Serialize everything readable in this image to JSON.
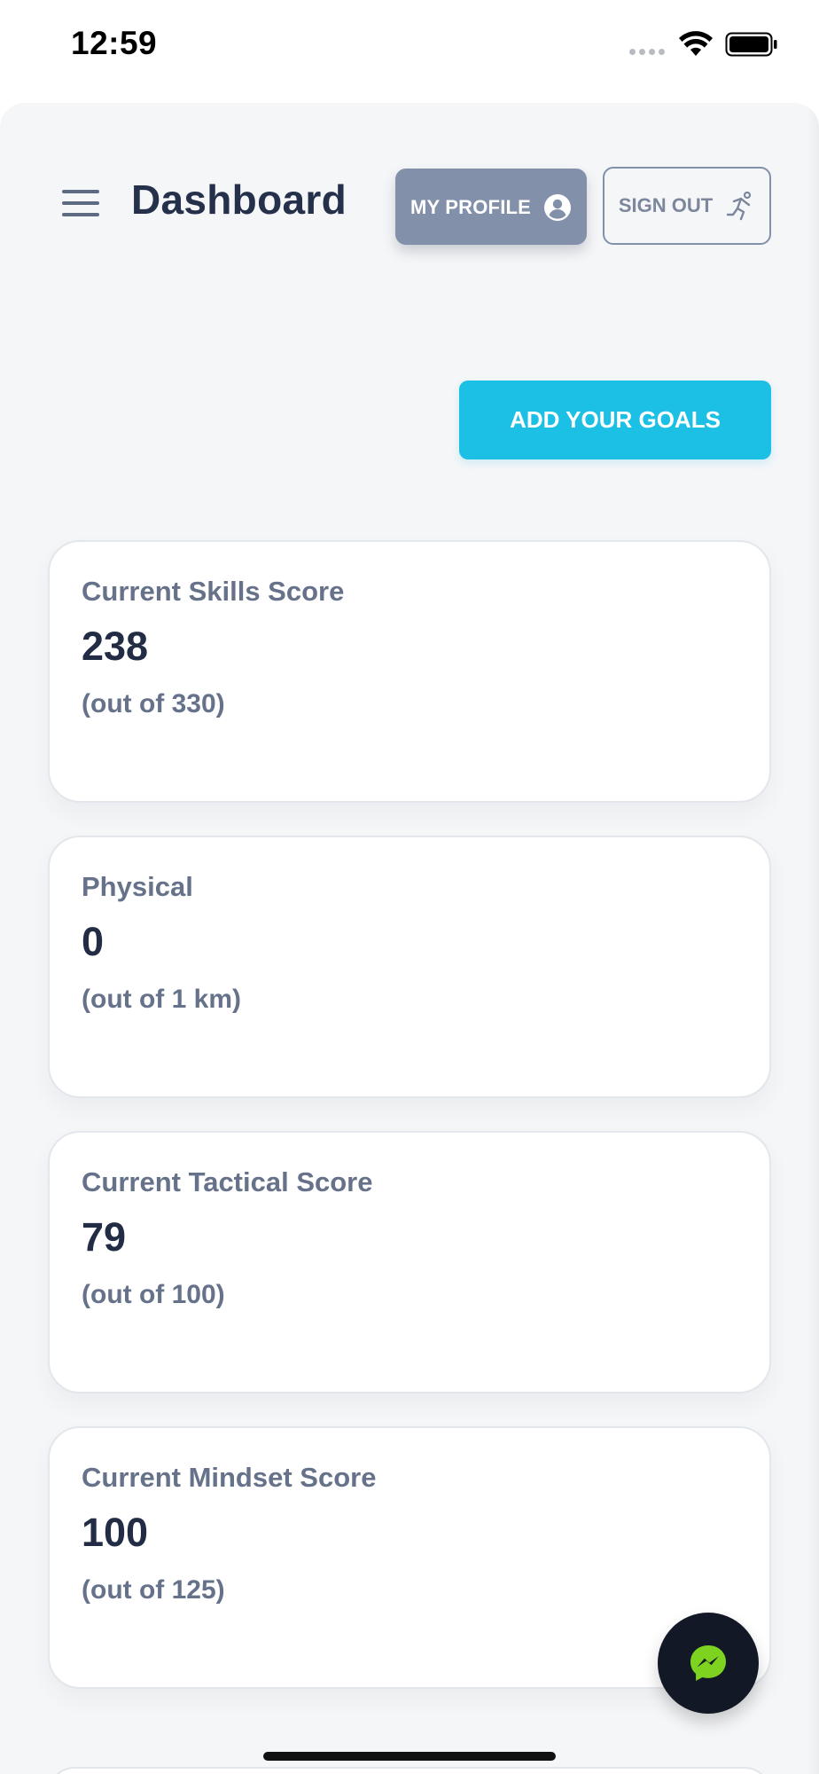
{
  "status_bar": {
    "time": "12:59"
  },
  "header": {
    "title": "Dashboard",
    "profile_button": {
      "label": "MY PROFILE",
      "icon": "user-circle-icon"
    },
    "signout_button": {
      "label": "SIGN OUT",
      "icon": "running-person-icon"
    },
    "menu_icon": "hamburger-menu-icon"
  },
  "main": {
    "goals_button_label": "ADD YOUR GOALS",
    "cards": [
      {
        "label": "Current Skills Score",
        "value": "238",
        "subtext": "(out of 330)"
      },
      {
        "label": "Physical",
        "value": "0",
        "subtext": "(out of 1 km)"
      },
      {
        "label": "Current Tactical Score",
        "value": "79",
        "subtext": "(out of 100)"
      },
      {
        "label": "Current Mindset Score",
        "value": "100",
        "subtext": "(out of 125)"
      }
    ]
  },
  "colors": {
    "accent": "#1cc0e5",
    "profile_button": "#8290aa",
    "title_text": "#25304a",
    "muted_text": "#66718a",
    "messenger_green": "#7ed321"
  },
  "floating_button": {
    "icon": "messenger-icon"
  }
}
